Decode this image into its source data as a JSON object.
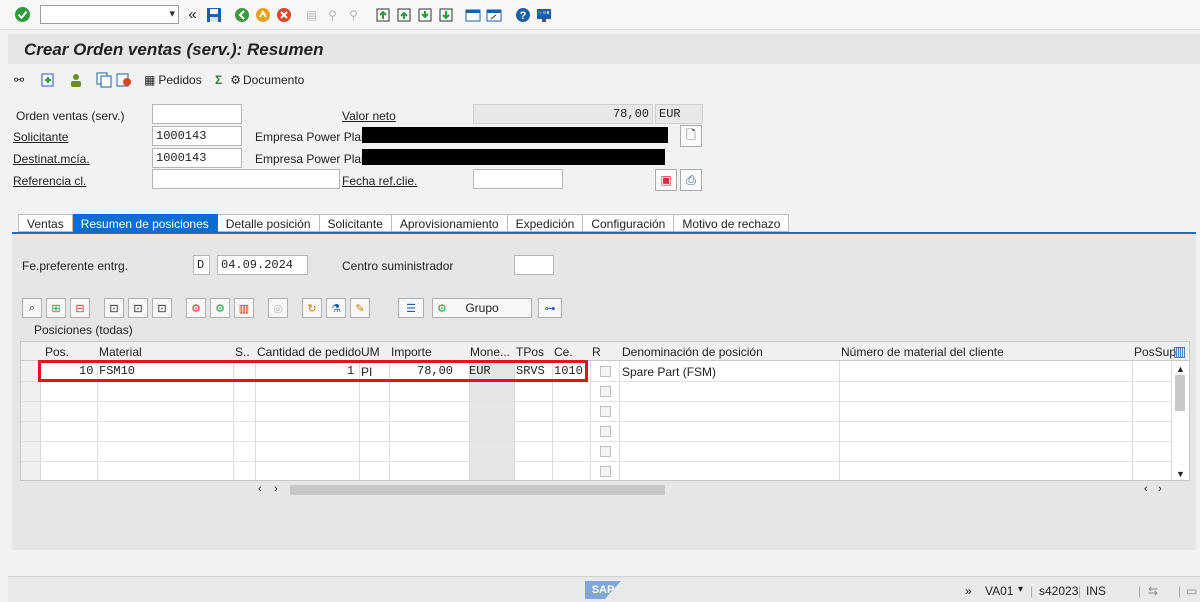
{
  "toolbar": {
    "command_value": "",
    "chevron": "«"
  },
  "title": "Crear Orden ventas (serv.): Resumen",
  "apptb": {
    "pedidos_label": "Pedidos",
    "documento_label": "Documento"
  },
  "header": {
    "orden_label": "Orden ventas (serv.)",
    "orden_value": "",
    "valor_neto_label": "Valor neto",
    "valor_neto_value": "78,00",
    "currency": "EUR",
    "solicitante_label": "Solicitante",
    "solicitante_value": "1000143",
    "solicitante_name": "Empresa Power Plant",
    "destinat_label": "Destinat.mcía.",
    "destinat_value": "1000143",
    "destinat_name": "Empresa Power Plant",
    "referencia_label": "Referencia cl.",
    "referencia_value": "",
    "fecha_ref_label": "Fecha ref.clie.",
    "fecha_ref_value": ""
  },
  "tabs": [
    "Ventas",
    "Resumen de posiciones",
    "Detalle posición",
    "Solicitante",
    "Aprovisionamiento",
    "Expedición",
    "Configuración",
    "Motivo de rechazo"
  ],
  "panel": {
    "fe_pref_label": "Fe.preferente entrg.",
    "fe_pref_format": "D",
    "fe_pref_value": "04.09.2024",
    "centro_label": "Centro suministrador",
    "centro_value": "",
    "grupo_label": "Grupo",
    "positions_title": "Posiciones (todas)"
  },
  "columns": [
    "Pos.",
    "Material",
    "S..",
    "Cantidad de pedido",
    "UM",
    "Importe",
    "Mone...",
    "TPos",
    "Ce.",
    "R",
    "Denominación de posición",
    "Número de material del cliente",
    "PosSup"
  ],
  "row1": {
    "pos": "10",
    "material": "FSM10",
    "cantidad": "1",
    "um": "PI",
    "importe": "78,00",
    "moneda": "EUR",
    "tpos": "SRVS",
    "ce": "1010",
    "denominacion": "Spare Part (FSM)"
  },
  "status": {
    "chevron": "»",
    "transaction": "VA01",
    "server": "s42023",
    "mode": "INS",
    "logo": "SAP"
  },
  "colors": {
    "accent": "#0a6ed1",
    "highlight": "#e1141a"
  }
}
